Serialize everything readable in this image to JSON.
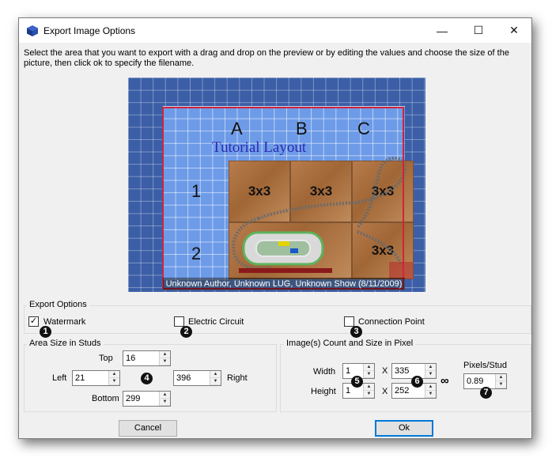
{
  "window": {
    "title": "Export Image Options",
    "minimize_glyph": "—",
    "maximize_glyph": "☐",
    "close_glyph": "✕",
    "icon": "blue-cube-icon"
  },
  "instructions": "Select the area that you want to export with a drag and drop on the preview or by editing the values and choose the size of the picture, then click ok to specify the filename.",
  "preview": {
    "columns": [
      "A",
      "B",
      "C"
    ],
    "rows": [
      "1",
      "2"
    ],
    "layout_title": "Tutorial Layout",
    "cells": [
      "3x3",
      "3x3",
      "3x3",
      "3",
      "3x3"
    ],
    "caption": "Unknown Author, Unknown LUG, Unknown Show (8/11/2009)"
  },
  "export_options": {
    "label": "Export Options",
    "watermark": {
      "label": "Watermark",
      "checked": true,
      "check_glyph": "✓",
      "badge": "1"
    },
    "electric_circuit": {
      "label": "Electric Circuit",
      "checked": false,
      "badge": "2"
    },
    "connection_point": {
      "label": "Connection Point",
      "checked": false,
      "badge": "3"
    }
  },
  "area_size": {
    "label": "Area Size in Studs",
    "top_label": "Top",
    "top_value": "16",
    "left_label": "Left",
    "left_value": "21",
    "right_label": "Right",
    "right_value": "396",
    "bottom_label": "Bottom",
    "bottom_value": "299",
    "badge": "4"
  },
  "image_size": {
    "label": "Image(s) Count and Size in Pixel",
    "width_label": "Width",
    "width_count": "1",
    "width_pixels": "335",
    "height_label": "Height",
    "height_count": "1",
    "height_pixels": "252",
    "x_symbol": "X",
    "pixels_per_stud_label": "Pixels/Stud",
    "pixels_per_stud_value": "0.89",
    "badge_count": "5",
    "badge_pixels": "6",
    "badge_ratio": "7"
  },
  "buttons": {
    "cancel": "Cancel",
    "ok": "Ok"
  },
  "spinner_up": "▲",
  "spinner_down": "▼",
  "chain_glyph": "∞"
}
